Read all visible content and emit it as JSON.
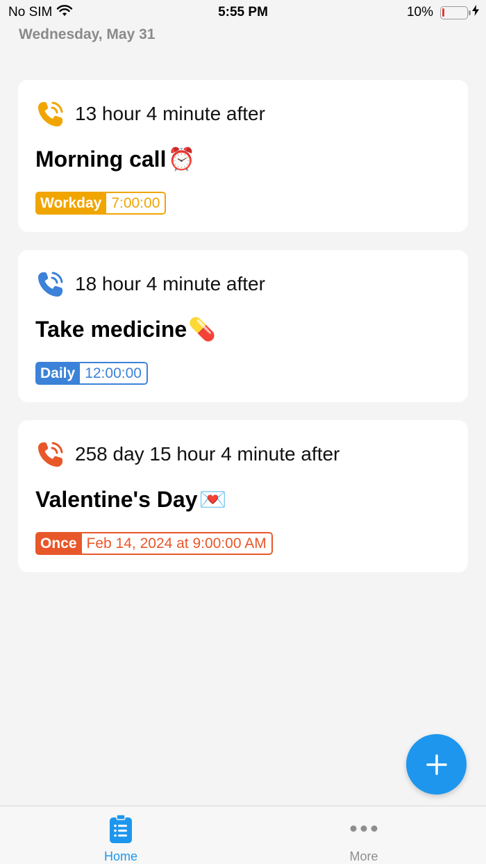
{
  "status_bar": {
    "carrier": "No SIM",
    "time": "5:55 PM",
    "battery": "10%",
    "battery_level": 0.1
  },
  "header": {
    "date": "Wednesday, May 31"
  },
  "reminders": [
    {
      "countdown": "13 hour 4 minute after",
      "title": "Morning call",
      "emoji": "⏰",
      "repeat": "Workday",
      "time": "7:00:00",
      "color": "#f0a500",
      "icon": "phone-ringing-icon"
    },
    {
      "countdown": "18 hour 4 minute after",
      "title": "Take medicine",
      "emoji": "💊",
      "repeat": "Daily",
      "time": "12:00:00",
      "color": "#3b82d8",
      "icon": "phone-ringing-icon"
    },
    {
      "countdown": "258 day 15 hour 4 minute after",
      "title": "Valentine's Day",
      "emoji": "💌",
      "repeat": "Once",
      "time": "Feb 14, 2024 at 9:00:00 AM",
      "color": "#e8572a",
      "icon": "phone-ringing-icon"
    }
  ],
  "fab": {
    "icon": "plus-icon",
    "color": "#1e96ee"
  },
  "tab_bar": {
    "items": [
      {
        "label": "Home",
        "icon": "checklist-icon",
        "active": true
      },
      {
        "label": "More",
        "icon": "more-dots-icon",
        "active": false
      }
    ]
  }
}
